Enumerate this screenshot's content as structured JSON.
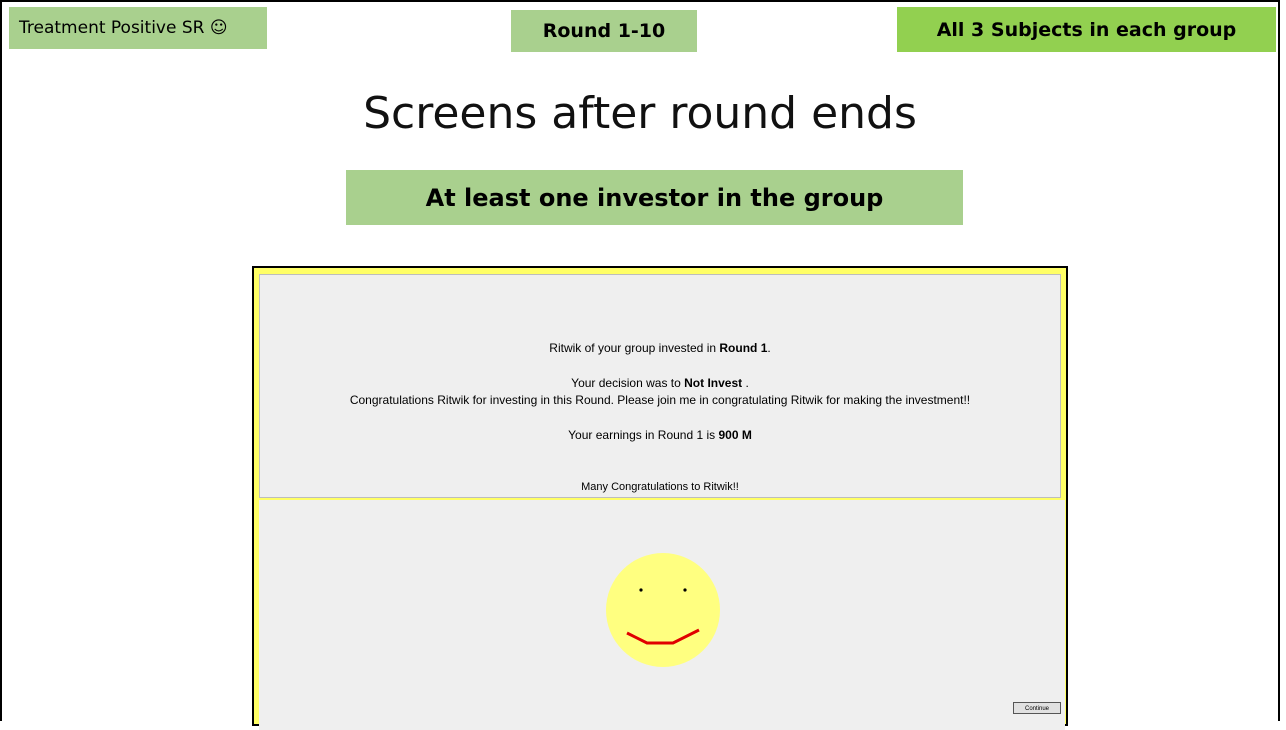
{
  "header": {
    "treatment_label": "Treatment Positive SR ☺",
    "round_label": "Round 1-10",
    "subjects_label": "All 3 Subjects in each group"
  },
  "title": "Screens after round ends",
  "subtitle": "At least one investor in the group",
  "screen": {
    "line1_prefix": "Ritwik of your group invested in ",
    "line1_bold": "Round 1",
    "line1_suffix": ".",
    "line2_prefix": "Your decision was to ",
    "line2_bold": "Not Invest",
    "line2_suffix": " .",
    "line3": "Congratulations Ritwik for investing in this Round. Please join me in congratulating Ritwik for making the investment!!",
    "line4_prefix": "Your earnings in Round 1 is ",
    "line4_bold": "900 M",
    "line5": "Many Congratulations to Ritwik!!",
    "continue_label": "Continue"
  },
  "colors": {
    "tag_green": "#a9d08e",
    "tag_bright_green": "#92d050",
    "screen_border": "#ffff66",
    "smiley_face": "#ffff80",
    "smile": "#e00000"
  },
  "icons": {
    "smiley": "smiley-face-icon"
  }
}
